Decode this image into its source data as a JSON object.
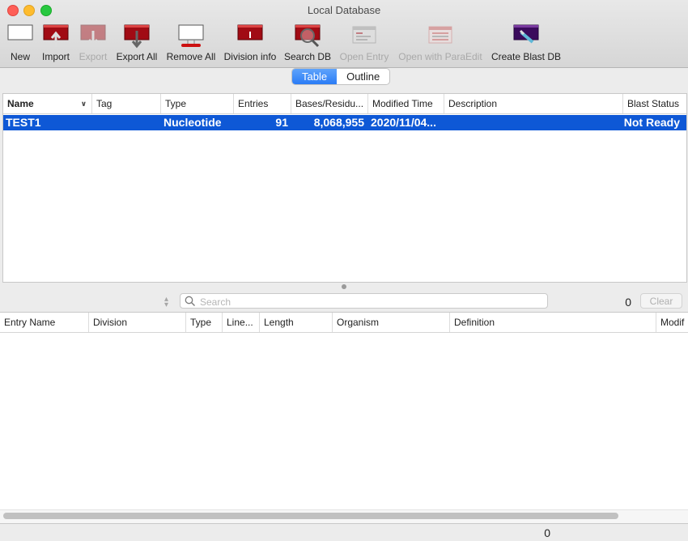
{
  "window": {
    "title": "Local Database"
  },
  "toolbar": {
    "new": "New",
    "import": "Import",
    "export": "Export",
    "export_all": "Export All",
    "remove_all": "Remove All",
    "division_info": "Division info",
    "search_db": "Search DB",
    "open_entry": "Open Entry",
    "open_paraedit": "Open with ParaEdit",
    "create_blast_db": "Create Blast DB"
  },
  "view_toggle": {
    "table": "Table",
    "outline": "Outline",
    "selected": "Table"
  },
  "db_table": {
    "columns": [
      "Name",
      "Tag",
      "Type",
      "Entries",
      "Bases/Residu...",
      "Modified Time",
      "Description",
      "Blast Status"
    ],
    "rows": [
      {
        "name": "TEST1",
        "tag": "",
        "type": "Nucleotide",
        "entries": "91",
        "bases": "8,068,955",
        "modified": "2020/11/04...",
        "description": "",
        "blast_status": "Not Ready"
      }
    ]
  },
  "search": {
    "placeholder": "Search",
    "value": "",
    "count": "0",
    "clear": "Clear"
  },
  "entry_table": {
    "columns": [
      "Entry Name",
      "Division",
      "Type",
      "Line...",
      "Length",
      "Organism",
      "Definition",
      "Modif"
    ]
  },
  "status": {
    "count": "0"
  },
  "colors": {
    "selection": "#0e58d6",
    "accent": "#2a7cf6",
    "db_red": "#a10b14"
  }
}
